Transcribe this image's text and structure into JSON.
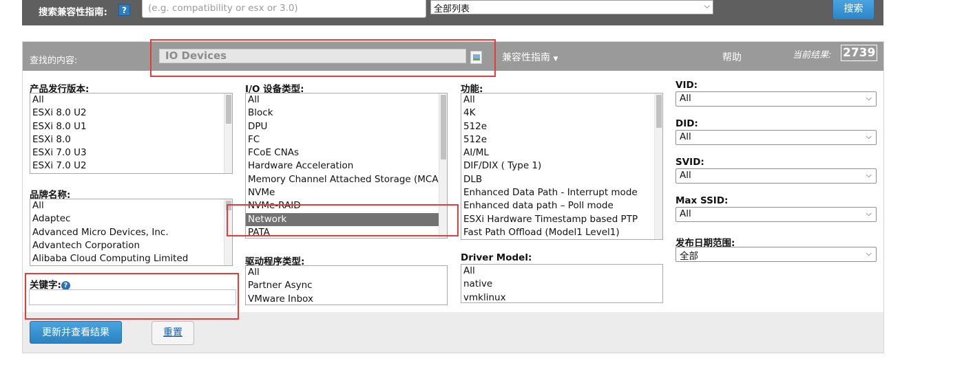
{
  "top": {
    "label": "搜索兼容性指南:",
    "help_glyph": "?",
    "search_placeholder": "(e.g. compatibility or esx or 3.0)",
    "list_select": "全部列表",
    "search_button": "搜索"
  },
  "header": {
    "look_for_label": "查找的内容:",
    "look_for_value": "IO Devices",
    "compat_menu": "兼容性指南",
    "help_link": "帮助",
    "result_label": "当前结果:",
    "result_count": "2739"
  },
  "release": {
    "label": "产品发行版本:",
    "options": [
      "All",
      "ESXi 8.0 U2",
      "ESXi 8.0 U1",
      "ESXi 8.0",
      "ESXi 7.0 U3",
      "ESXi 7.0 U2"
    ]
  },
  "brand": {
    "label": "品牌名称:",
    "options": [
      "All",
      "Adaptec",
      "Advanced Micro Devices, Inc.",
      "Advantech Corporation",
      "Alibaba Cloud Computing Limited"
    ]
  },
  "keyword": {
    "label": "关键字:",
    "info_glyph": "?",
    "value": ""
  },
  "io_type": {
    "label": "I/O 设备类型:",
    "options": [
      "All",
      "Block",
      "DPU",
      "FC",
      "FCoE CNAs",
      "Hardware Acceleration",
      "Memory Channel Attached Storage (MCAS)",
      "NVMe",
      "NVMe-RAID",
      "Network",
      "PATA"
    ],
    "selected": "Network"
  },
  "driver_type": {
    "label": "驱动程序类型:",
    "options": [
      "All",
      "Partner Async",
      "VMware Inbox"
    ]
  },
  "features": {
    "label": "功能:",
    "options": [
      "All",
      "4K",
      "512e",
      "512e",
      "AI/ML",
      "DIF/DIX ( Type 1)",
      "DLB",
      "Enhanced Data Path - Interrupt mode",
      "Enhanced data path – Poll mode",
      "ESXi Hardware Timestamp based PTP",
      "Fast Path Offload (Model1 Level1)"
    ]
  },
  "driver_model": {
    "label": "Driver Model:",
    "options": [
      "All",
      "native",
      "vmklinux"
    ]
  },
  "vid": {
    "label": "VID:",
    "value": "All"
  },
  "did": {
    "label": "DID:",
    "value": "All"
  },
  "svid": {
    "label": "SVID:",
    "value": "All"
  },
  "max_ssid": {
    "label": "Max SSID:",
    "value": "All"
  },
  "date_range": {
    "label": "发布日期范围:",
    "value": "全部"
  },
  "actions": {
    "update_button": "更新并查看结果",
    "reset_button": "重置"
  },
  "colors": {
    "top_bar": "#5f5f5f",
    "header_bar": "#9a9a9a",
    "accent_blue": "#2b86c8",
    "selected_option": "#727272",
    "highlight_red": "#e53b3b"
  }
}
